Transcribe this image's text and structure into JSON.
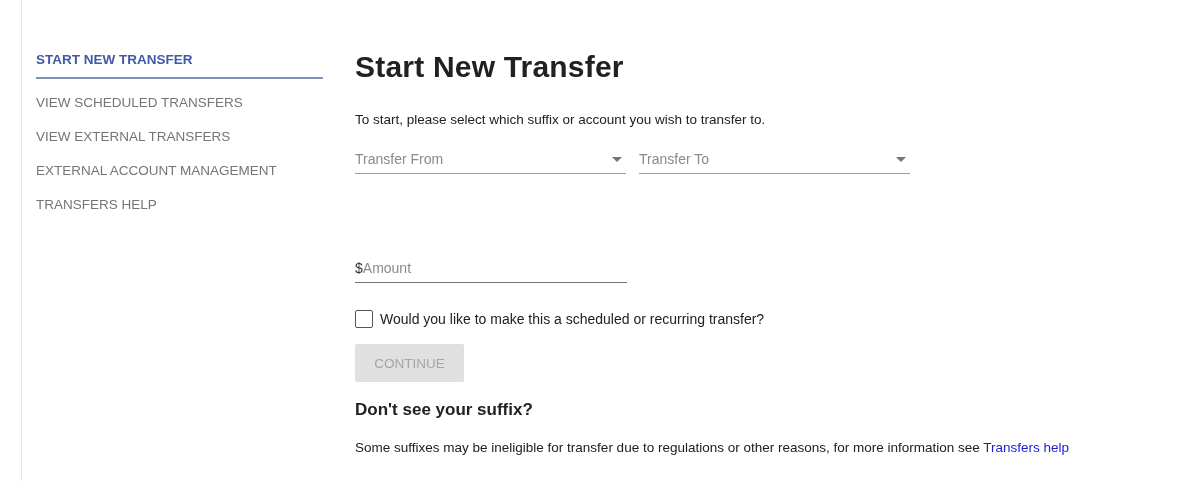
{
  "sidebar": {
    "items": [
      {
        "label": "START NEW TRANSFER",
        "selected": true
      },
      {
        "label": "VIEW SCHEDULED TRANSFERS",
        "selected": false
      },
      {
        "label": "VIEW EXTERNAL TRANSFERS",
        "selected": false
      },
      {
        "label": "EXTERNAL ACCOUNT MANAGEMENT",
        "selected": false
      },
      {
        "label": "TRANSFERS HELP",
        "selected": false
      }
    ]
  },
  "title": "Start New Transfer",
  "instruction": "To start, please select which suffix or account you wish to transfer to.",
  "selects": [
    {
      "placeholder": "Transfer From"
    },
    {
      "placeholder": "Transfer To"
    }
  ],
  "amount": {
    "prefix": "$",
    "placeholder": "Amount"
  },
  "recurring": {
    "label": "Would you like to make this a scheduled or recurring transfer?",
    "checked": false
  },
  "continue_button": {
    "label": "CONTINUE",
    "disabled": true
  },
  "help": {
    "heading": "Don't see your suffix?",
    "text": "Some suffixes may be ineligible for transfer due to regulations or other reasons, for more information see",
    "link": "Transfers help"
  }
}
